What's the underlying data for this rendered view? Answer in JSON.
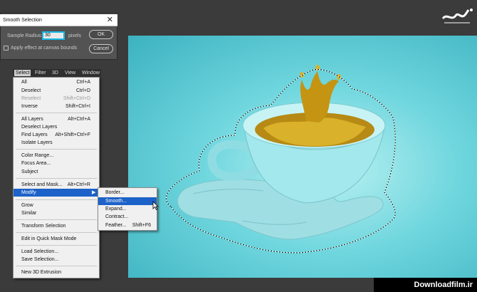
{
  "dialog": {
    "title": "Smooth Selection",
    "radius_label": "Sample Radius:",
    "radius_value": "30",
    "radius_unit": "pixels",
    "checkbox_label": "Apply effect at canvas bounds",
    "ok_label": "OK",
    "cancel_label": "Cancel"
  },
  "menubar": [
    "Select",
    "Filter",
    "3D",
    "View",
    "Window"
  ],
  "select_menu": {
    "items": [
      {
        "label": "All",
        "shortcut": "Ctrl+A"
      },
      {
        "label": "Deselect",
        "shortcut": "Ctrl+D"
      },
      {
        "label": "Reselect",
        "shortcut": "Shift+Ctrl+D",
        "disabled": true
      },
      {
        "label": "Inverse",
        "shortcut": "Shift+Ctrl+I"
      },
      {
        "label": "All Layers",
        "shortcut": "Alt+Ctrl+A"
      },
      {
        "label": "Deselect Layers",
        "shortcut": ""
      },
      {
        "label": "Find Layers",
        "shortcut": "Alt+Shift+Ctrl+F"
      },
      {
        "label": "Isolate Layers",
        "shortcut": ""
      },
      {
        "label": "Color Range...",
        "shortcut": ""
      },
      {
        "label": "Focus Area...",
        "shortcut": ""
      },
      {
        "label": "Subject",
        "shortcut": ""
      },
      {
        "label": "Select and Mask...",
        "shortcut": "Alt+Ctrl+R"
      },
      {
        "label": "Modify",
        "shortcut": ""
      },
      {
        "label": "Grow",
        "shortcut": ""
      },
      {
        "label": "Similar",
        "shortcut": ""
      },
      {
        "label": "Transform Selection",
        "shortcut": ""
      },
      {
        "label": "Edit in Quick Mask Mode",
        "shortcut": ""
      },
      {
        "label": "Load Selection...",
        "shortcut": ""
      },
      {
        "label": "Save Selection...",
        "shortcut": ""
      },
      {
        "label": "New 3D Extrusion",
        "shortcut": ""
      }
    ]
  },
  "modify_menu": {
    "items": [
      {
        "label": "Border...",
        "shortcut": ""
      },
      {
        "label": "Smooth...",
        "shortcut": ""
      },
      {
        "label": "Expand...",
        "shortcut": ""
      },
      {
        "label": "Contract...",
        "shortcut": ""
      },
      {
        "label": "Feather...",
        "shortcut": "Shift+F6"
      }
    ]
  },
  "watermark": "Downloadfilm.ir",
  "colors": {
    "highlight": "#1c62c8",
    "focus_ring": "#18b7e4",
    "canvas_bg": "#6fd6de",
    "gold": "#c9a21c"
  }
}
